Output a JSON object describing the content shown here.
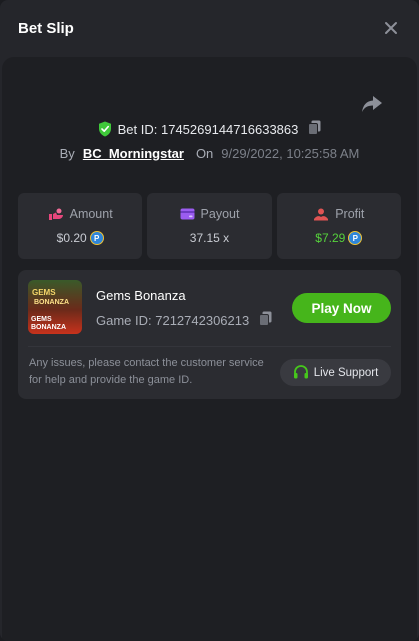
{
  "header": {
    "title": "Bet Slip"
  },
  "bet": {
    "id_label": "Bet ID: 1745269144716633863",
    "by_label": "By",
    "user": "BC_Morningstar",
    "on_label": "On",
    "date": "9/29/2022, 10:25:58 AM"
  },
  "stats": {
    "amount": {
      "label": "Amount",
      "value": "$0.20"
    },
    "payout": {
      "label": "Payout",
      "value": "37.15 x"
    },
    "profit": {
      "label": "Profit",
      "value": "$7.29"
    }
  },
  "game": {
    "name": "Gems Bonanza",
    "id_label": "Game ID: 7212742306213",
    "play_label": "Play Now",
    "thumb_text_1": "GEMS",
    "thumb_text_2": "BONANZA",
    "thumb_text_3": "GEMS BONANZA",
    "issue_text": "Any issues, please contact the customer service for help and provide the game ID.",
    "support_label": "Live Support"
  },
  "colors": {
    "accent_green": "#46b51b",
    "profit_green": "#56d23c",
    "verified_green": "#3fc93a",
    "amount_pink": "#e8467c",
    "payout_purple": "#9b5cf0",
    "profit_red": "#e05454"
  },
  "icons": [
    "close-icon",
    "share-icon",
    "shield-check-icon",
    "copy-icon",
    "amount-icon",
    "payout-icon",
    "profit-icon",
    "coin-icon",
    "headset-icon"
  ]
}
